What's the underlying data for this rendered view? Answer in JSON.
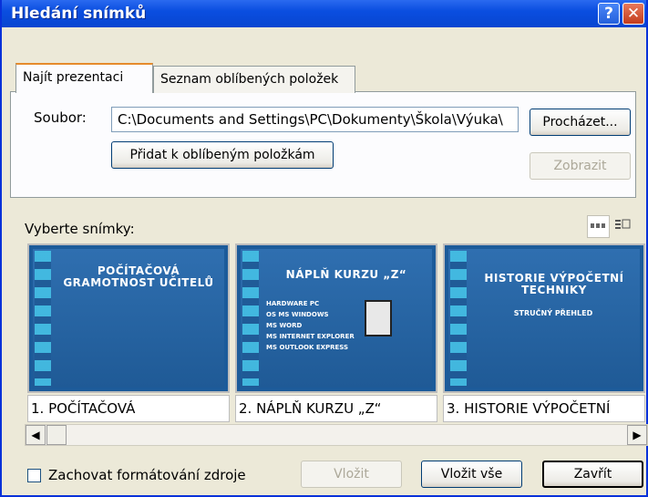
{
  "window": {
    "title": "Hledání snímků"
  },
  "titlebar": {
    "help_label": "?",
    "close_label": "✕"
  },
  "tabs": [
    {
      "label": "Najít prezentaci",
      "active": true
    },
    {
      "label": "Seznam oblíbených položek",
      "active": false
    }
  ],
  "file": {
    "label": "Soubor:",
    "path": "C:\\Documents and Settings\\PC\\Dokumenty\\Škola\\Výuka\\",
    "browse_label": "Procházet...",
    "add_favorites_label": "Přidat k oblíbeným položkám",
    "show_label": "Zobrazit"
  },
  "slides_label": "Vyberte snímky:",
  "slides": [
    {
      "caption": "1. POČÍTAČOVÁ",
      "title": "POČÍTAČOVÁ GRAMOTNOST UČITELŮ"
    },
    {
      "caption": "2. NÁPLŇ KURZU „Z“",
      "title": "NÁPLŇ KURZU „Z“",
      "bullets": [
        "HARDWARE PC",
        "OS MS WINDOWS",
        "MS WORD",
        "MS INTERNET EXPLORER",
        "MS OUTLOOK EXPRESS"
      ]
    },
    {
      "caption": "3. HISTORIE VÝPOČETNÍ",
      "title": "HISTORIE VÝPOČETNÍ TECHNIKY",
      "subtitle": "STRUČNÝ PŘEHLED"
    }
  ],
  "scrollbar": {
    "left_arrow": "◀",
    "right_arrow": "▶"
  },
  "footer": {
    "keep_format_label": "Zachovat formátování zdroje",
    "insert_label": "Vložit",
    "insert_all_label": "Vložit vše",
    "close_label": "Zavřít"
  },
  "icons": [
    "help-icon",
    "close-icon",
    "view-thumbnails-icon",
    "view-list-icon",
    "computer-icon"
  ]
}
